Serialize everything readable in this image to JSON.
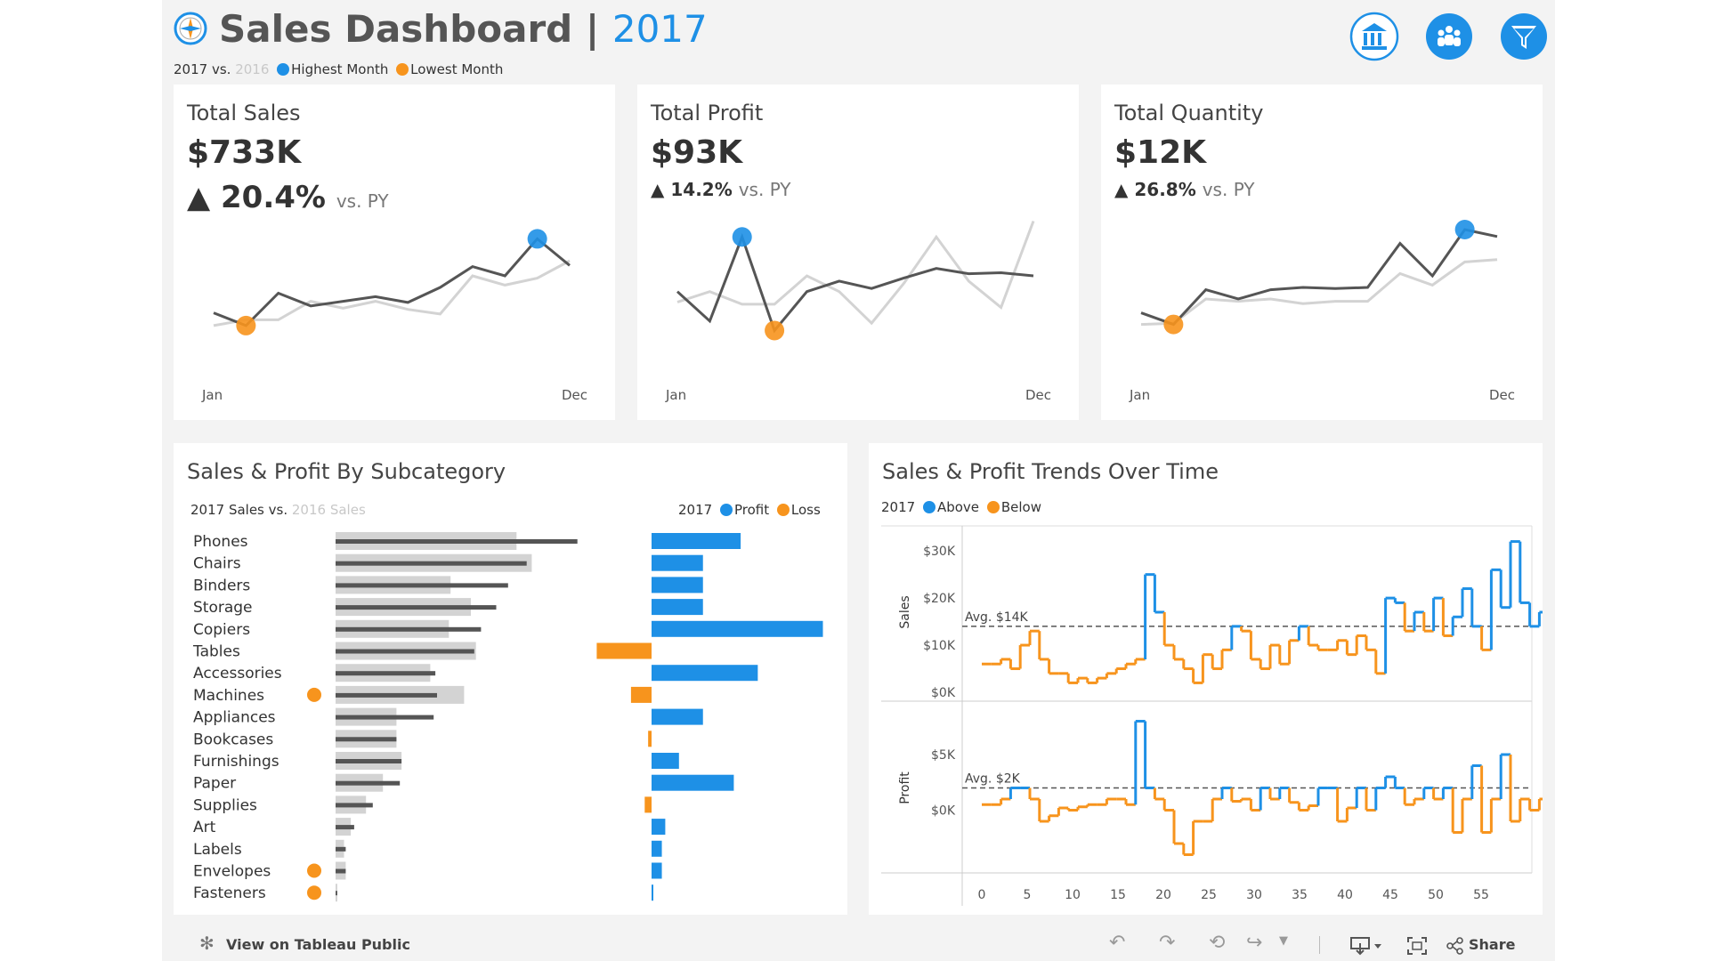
{
  "header": {
    "title": "Sales Dashboard",
    "separator": "|",
    "year": "2017",
    "compare_year": "2017 vs.",
    "prior_year": "2016",
    "highest_label": "Highest Month",
    "lowest_label": "Lowest Month",
    "icons": [
      "compass-icon",
      "bank-icon",
      "team-icon",
      "filter-icon"
    ]
  },
  "kpis": [
    {
      "title": "Total Sales",
      "value": "$733K",
      "arrow": "▲",
      "change": "20.4%",
      "vs": "vs. PY",
      "start": "Jan",
      "end": "Dec"
    },
    {
      "title": "Total Profit",
      "value": "$93K",
      "arrow": "▲",
      "change": "14.2%",
      "vs": "vs. PY",
      "start": "Jan",
      "end": "Dec"
    },
    {
      "title": "Total Quantity",
      "value": "$12K",
      "arrow": "▲",
      "change": "26.8%",
      "vs": "vs. PY",
      "start": "Jan",
      "end": "Dec"
    }
  ],
  "subcategory": {
    "title": "Sales & Profit By Subcategory",
    "sales_legend_a": "2017 Sales vs.",
    "sales_legend_b": "2016 Sales",
    "profit_legend_year": "2017",
    "profit_label": "Profit",
    "loss_label": "Loss"
  },
  "trends": {
    "title": "Sales & Profit Trends Over Time",
    "legend_year": "2017",
    "above_label": "Above",
    "below_label": "Below",
    "sales_axis": "Sales",
    "profit_axis": "Profit",
    "sales_avg": "Avg. $14K",
    "profit_avg": "Avg. $2K"
  },
  "toolbar": {
    "view_label": "View on Tableau Public",
    "share_label": "Share"
  },
  "colors": {
    "blue": "#1e90e6",
    "orange": "#f7941d",
    "dark_line": "#555555",
    "light_line": "#d3d3d3",
    "bar_gray": "#d3d3d3",
    "bar_dark": "#555555"
  },
  "chart_data": [
    {
      "type": "line",
      "title": "Total Sales",
      "x": [
        "Jan",
        "Feb",
        "Mar",
        "Apr",
        "May",
        "Jun",
        "Jul",
        "Aug",
        "Sep",
        "Oct",
        "Nov",
        "Dec"
      ],
      "series": [
        {
          "name": "2017",
          "values": [
            18,
            7,
            35,
            24,
            28,
            32,
            27,
            40,
            58,
            50,
            82,
            59
          ]
        },
        {
          "name": "2016",
          "values": [
            7,
            12,
            12,
            28,
            22,
            28,
            21,
            17,
            50,
            42,
            48,
            63
          ]
        }
      ],
      "highest_index": 10,
      "lowest_index": 1,
      "ylim": [
        0,
        100
      ]
    },
    {
      "type": "line",
      "title": "Total Profit",
      "x": [
        "Jan",
        "Feb",
        "Mar",
        "Apr",
        "May",
        "Jun",
        "Jul",
        "Aug",
        "Sep",
        "Oct",
        "Nov",
        "Dec"
      ],
      "series": [
        {
          "name": "2017",
          "values": [
            30,
            2,
            82,
            -7,
            30,
            40,
            33,
            43,
            52,
            47,
            48,
            45
          ]
        },
        {
          "name": "2016",
          "values": [
            20,
            30,
            18,
            18,
            45,
            30,
            0,
            38,
            82,
            40,
            15,
            97
          ]
        }
      ],
      "highest_index": 2,
      "lowest_index": 3,
      "ylim": [
        -10,
        100
      ]
    },
    {
      "type": "line",
      "title": "Total Quantity",
      "x": [
        "Jan",
        "Feb",
        "Mar",
        "Apr",
        "May",
        "Jun",
        "Jul",
        "Aug",
        "Sep",
        "Oct",
        "Nov",
        "Dec"
      ],
      "series": [
        {
          "name": "2017",
          "values": [
            18,
            8,
            38,
            30,
            38,
            40,
            39,
            40,
            78,
            50,
            90,
            84
          ]
        },
        {
          "name": "2016",
          "values": [
            8,
            9,
            30,
            28,
            30,
            26,
            28,
            28,
            52,
            42,
            62,
            64
          ]
        }
      ],
      "highest_index": 10,
      "lowest_index": 1,
      "ylim": [
        0,
        100
      ]
    },
    {
      "type": "bar",
      "title": "Sales & Profit By Subcategory",
      "categories": [
        "Phones",
        "Chairs",
        "Binders",
        "Storage",
        "Copiers",
        "Tables",
        "Accessories",
        "Machines",
        "Appliances",
        "Bookcases",
        "Furnishings",
        "Paper",
        "Supplies",
        "Art",
        "Labels",
        "Envelopes",
        "Fasteners"
      ],
      "series": [
        {
          "name": "2017 Sales",
          "values": [
            143,
            113,
            102,
            95,
            86,
            82,
            59,
            60,
            58,
            36,
            39,
            38,
            22,
            11,
            6,
            6,
            1
          ]
        },
        {
          "name": "2016 Sales",
          "values": [
            107,
            116,
            68,
            80,
            67,
            83,
            56,
            76,
            36,
            36,
            39,
            28,
            18,
            9,
            5,
            6,
            1
          ]
        },
        {
          "name": "Profit",
          "values": [
            26,
            15,
            15,
            15,
            50,
            -16,
            31,
            -6,
            15,
            -1,
            8,
            24,
            -2,
            4,
            3,
            3,
            0.4
          ]
        }
      ],
      "orange_dot_rows": [
        "Machines",
        "Envelopes",
        "Fasteners"
      ]
    },
    {
      "type": "line",
      "title": "Sales & Profit Trends Over Time",
      "x_ticks": [
        0,
        5,
        10,
        15,
        20,
        25,
        30,
        35,
        40,
        45,
        50,
        55
      ],
      "sales_yticks": [
        "$0K",
        "$10K",
        "$20K",
        "$30K"
      ],
      "profit_yticks": [
        "$0K",
        "$5K"
      ],
      "sales_avg": 14,
      "profit_avg": 2,
      "series": [
        {
          "name": "Sales",
          "values": [
            6,
            6,
            7,
            5,
            10,
            13,
            7,
            4,
            4,
            2,
            3,
            2,
            3,
            4,
            5,
            6,
            7,
            25,
            17,
            10,
            7,
            5,
            2,
            8,
            5,
            9,
            14,
            13,
            7,
            5,
            10,
            6,
            11,
            14,
            10,
            9,
            9,
            11,
            8,
            12,
            9,
            4,
            20,
            19,
            13,
            17,
            13,
            20,
            12,
            16,
            22,
            14,
            9,
            26,
            18,
            32,
            19,
            14,
            17,
            13
          ]
        },
        {
          "name": "Profit",
          "values": [
            0.5,
            0.5,
            1,
            2,
            2,
            1,
            -1,
            -0.5,
            0.2,
            0,
            0.3,
            0.5,
            0.5,
            1,
            1,
            0.5,
            8,
            2,
            1,
            0,
            -3,
            -4,
            -1,
            -1,
            1,
            2,
            0.8,
            1,
            0,
            2,
            1,
            2,
            0.7,
            0,
            0.4,
            2,
            2,
            -1,
            0.2,
            2,
            0,
            2,
            3,
            2,
            0.5,
            1,
            2,
            1,
            2,
            -2,
            1,
            4,
            -2,
            1,
            5,
            -1,
            1,
            0,
            1,
            2
          ]
        }
      ]
    }
  ]
}
